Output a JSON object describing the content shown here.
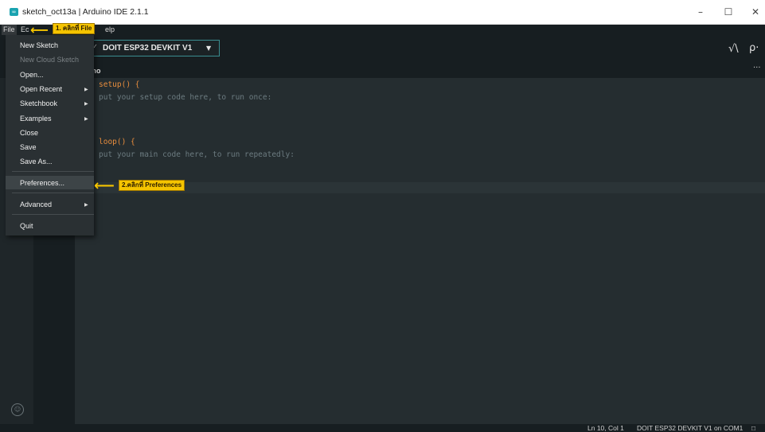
{
  "window": {
    "title": "sketch_oct13a | Arduino IDE 2.1.1",
    "minimize_glyph": "–",
    "maximize_glyph": "☐",
    "close_glyph": "✕",
    "logo_glyph": "∞"
  },
  "menubar": {
    "file": "File",
    "edit_fragment": "Ec",
    "help_fragment": "elp"
  },
  "toolbar": {
    "board": "DOIT ESP32 DEVKIT V1",
    "board_tick": "✓",
    "board_caret": "▼",
    "serial_plotter_icon": "√\\",
    "serial_monitor_icon": "ρ·"
  },
  "tabs": {
    "file_fragment": "ino",
    "more": "···"
  },
  "editor": {
    "lines": [
      {
        "kw": "setup() {",
        "comment": ""
      },
      {
        "kw": "",
        "comment": "put your setup code here, to run once:"
      },
      {
        "kw": "loop() {",
        "comment": ""
      },
      {
        "kw": "",
        "comment": "put your main code here, to run repeatedly:"
      }
    ]
  },
  "file_menu": {
    "items": [
      {
        "label": "New Sketch",
        "disabled": false,
        "submenu": false
      },
      {
        "label": "New Cloud Sketch",
        "disabled": true,
        "submenu": false
      },
      {
        "label": "Open...",
        "disabled": false,
        "submenu": false
      },
      {
        "label": "Open Recent",
        "disabled": false,
        "submenu": true
      },
      {
        "label": "Sketchbook",
        "disabled": false,
        "submenu": true
      },
      {
        "label": "Examples",
        "disabled": false,
        "submenu": true
      },
      {
        "label": "Close",
        "disabled": false,
        "submenu": false
      },
      {
        "label": "Save",
        "disabled": false,
        "submenu": false
      },
      {
        "label": "Save As...",
        "disabled": false,
        "submenu": false
      },
      {
        "label": "Preferences...",
        "disabled": false,
        "submenu": false
      },
      {
        "label": "Advanced",
        "disabled": false,
        "submenu": true
      },
      {
        "label": "Quit",
        "disabled": false,
        "submenu": false
      }
    ],
    "submenu_glyph": "▶"
  },
  "annotations": {
    "step1": "1. คลิกที่ File",
    "step2": "2.คลิกที่ Preferences",
    "arrow_glyph": "⟵"
  },
  "status": {
    "position": "Ln 10, Col 1",
    "board_port": "DOIT ESP32 DEVKIT V1 on COM1",
    "notification_icon": "🗆"
  },
  "profile_icon": "👤",
  "colors": {
    "accent_teal": "#3b8d90",
    "keyword_orange": "#e88d3d",
    "callout_yellow": "#f5c400"
  }
}
